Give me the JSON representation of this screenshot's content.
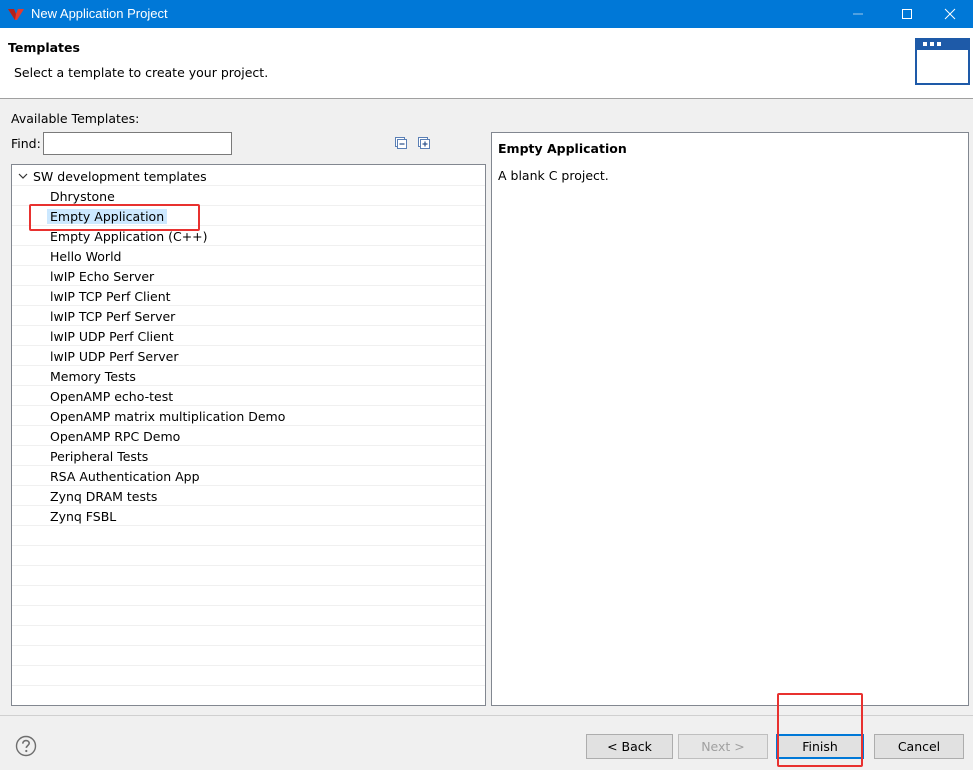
{
  "window": {
    "title": "New Application Project"
  },
  "banner": {
    "title": "Templates",
    "description": "Select a template to create your project."
  },
  "main": {
    "available_label": "Available Templates:",
    "find_label": "Find:",
    "find_value": "",
    "tree": {
      "category": "SW development templates",
      "items": [
        "Dhrystone",
        "Empty Application",
        "Empty Application (C++)",
        "Hello World",
        "lwIP Echo Server",
        "lwIP TCP Perf Client",
        "lwIP TCP Perf Server",
        "lwIP UDP Perf Client",
        "lwIP UDP Perf Server",
        "Memory Tests",
        "OpenAMP echo-test",
        "OpenAMP matrix multiplication Demo",
        "OpenAMP RPC Demo",
        "Peripheral Tests",
        "RSA Authentication App",
        "Zynq DRAM tests",
        "Zynq FSBL"
      ],
      "selected_item": "Empty Application"
    },
    "description": {
      "title": "Empty Application",
      "text": "A blank C project."
    }
  },
  "footer": {
    "back_label": "< Back",
    "next_label": "Next >",
    "finish_label": "Finish",
    "cancel_label": "Cancel"
  },
  "colors": {
    "titlebar": "#0078d7",
    "selection": "#cce8ff",
    "annotation": "#e8312f"
  }
}
